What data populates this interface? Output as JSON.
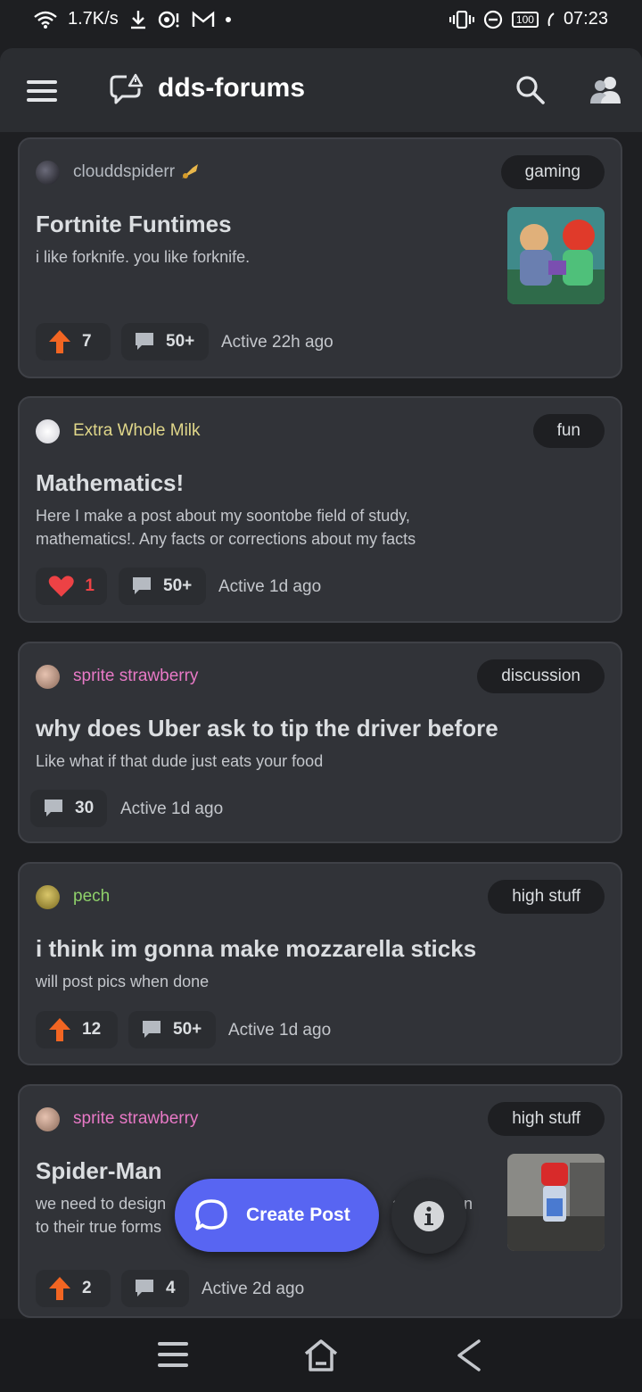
{
  "status_bar": {
    "speed": "1.7K/s",
    "battery": "100",
    "time": "07:23"
  },
  "app_bar": {
    "title": "dds-forums"
  },
  "posts": [
    {
      "author": "clouddspiderr",
      "author_color": "#b5bac1",
      "tag": "gaming",
      "title": "Fortnite Funtimes",
      "body": "i like forknife. you like forknife.",
      "reaction_count": "7",
      "reaction": "upvote",
      "comments": "50+",
      "activity": "Active 22h ago"
    },
    {
      "author": "Extra Whole Milk",
      "author_color": "#e0d78a",
      "tag": "fun",
      "title": "Mathematics!",
      "body": "Here I make a post about my soontobe field of study, mathematics!. Any facts or corrections about my facts",
      "reaction_count": "1",
      "reaction": "heart",
      "comments": "50+",
      "activity": "Active 1d ago"
    },
    {
      "author": "sprite strawberry",
      "author_color": "#e879c6",
      "tag": "discussion",
      "title": "why does Uber ask to tip the driver before",
      "body": "Like what if that dude just eats your food",
      "comments": "30",
      "activity": "Active 1d ago"
    },
    {
      "author": "pech",
      "author_color": "#8fd16a",
      "tag": "high stuff",
      "title": "i think im gonna make mozzarella sticks",
      "body": "will post pics when done",
      "reaction_count": "12",
      "reaction": "upvote",
      "comments": "50+",
      "activity": "Active 1d ago"
    },
    {
      "author": "sprite strawberry",
      "author_color": "#e879c6",
      "tag": "high stuff",
      "title": "Spider-Man",
      "body_line1": "we need to design",
      "body_line1_tail": "an",
      "body_line1_end": "n",
      "body_line2": "to their true forms",
      "reaction_count": "2",
      "reaction": "upvote",
      "comments": "4",
      "activity": "Active 2d ago"
    }
  ],
  "fab": {
    "label": "Create Post"
  },
  "colors": {
    "accent": "#5865f2",
    "upvote": "#f26522",
    "heart": "#ed4245",
    "card": "#313338",
    "background": "#1e1f22"
  }
}
